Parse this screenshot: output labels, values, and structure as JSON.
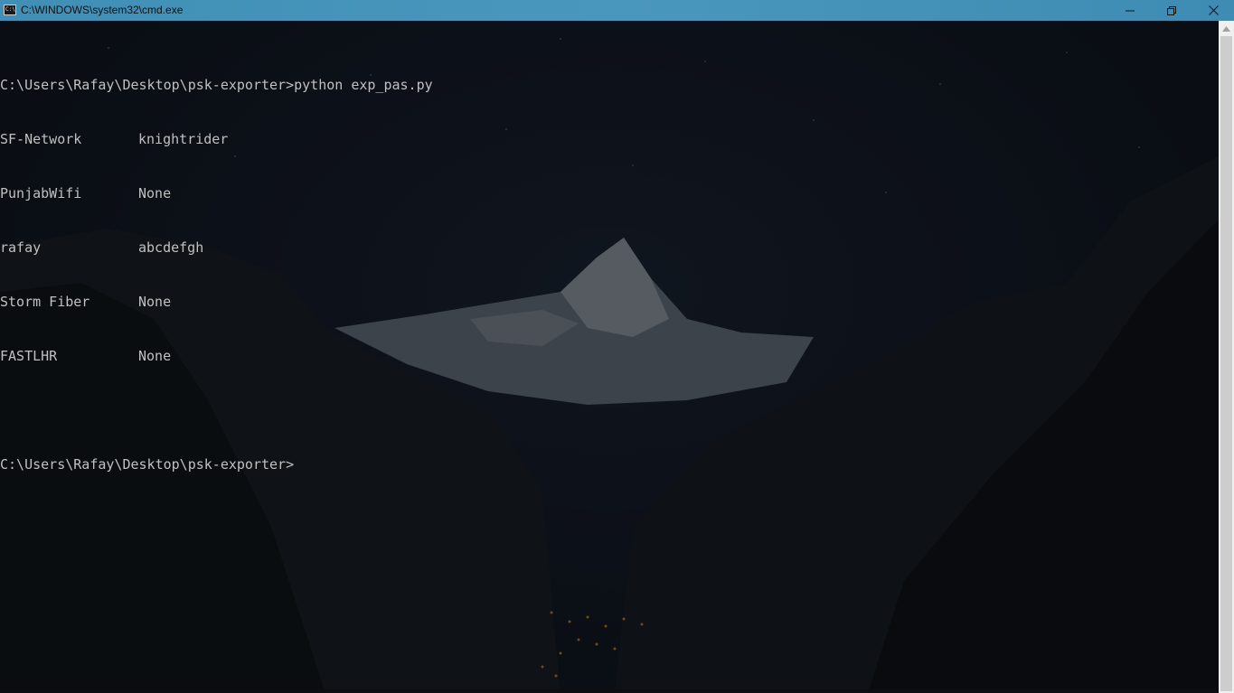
{
  "window": {
    "title": "C:\\WINDOWS\\system32\\cmd.exe",
    "icon": "cmd-icon",
    "controls": {
      "minimize": "minimize-icon",
      "maximize": "restore-icon",
      "close": "close-icon"
    }
  },
  "console": {
    "prompt_command": "C:\\Users\\Rafay\\Desktop\\psk-exporter>python exp_pas.py",
    "rows": [
      {
        "ssid": "SF-Network",
        "password": "knightrider"
      },
      {
        "ssid": "PunjabWifi",
        "password": "None"
      },
      {
        "ssid": "rafay",
        "password": "abcdefgh"
      },
      {
        "ssid": "Storm Fiber",
        "password": "None"
      },
      {
        "ssid": "FASTLHR",
        "password": "None"
      }
    ],
    "prompt_final": "C:\\Users\\Rafay\\Desktop\\psk-exporter>"
  },
  "colors": {
    "titlebar": "#4a97bd",
    "console_text": "#c0c0c0",
    "console_bg": "#0b0e12"
  }
}
